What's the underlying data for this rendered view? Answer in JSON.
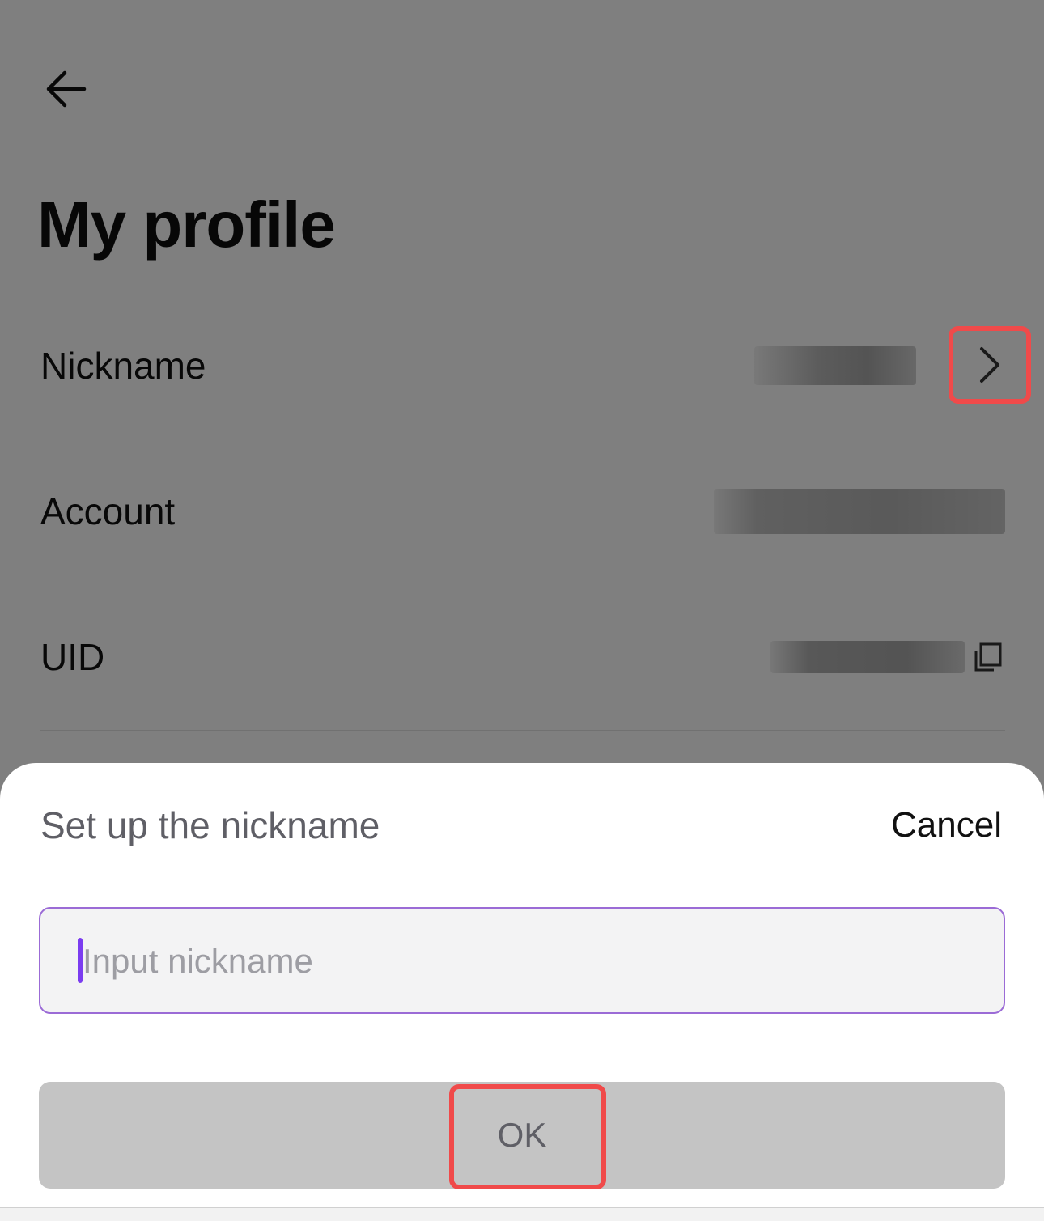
{
  "page": {
    "title": "My profile",
    "rows": {
      "nickname_label": "Nickname",
      "account_label": "Account",
      "uid_label": "UID"
    },
    "icons": {
      "back": "arrow-left-icon",
      "nickname_chevron": "chevron-right-icon",
      "uid_copy": "copy-icon"
    }
  },
  "sheet": {
    "title": "Set up the nickname",
    "cancel_label": "Cancel",
    "input": {
      "value": "",
      "placeholder": "Input nickname"
    },
    "ok_label": "OK"
  },
  "colors": {
    "highlight": "#f04a4a",
    "input_focus_border": "#9b6bd6",
    "caret": "#7b3cf0",
    "disabled_button": "#c4c4c4"
  }
}
